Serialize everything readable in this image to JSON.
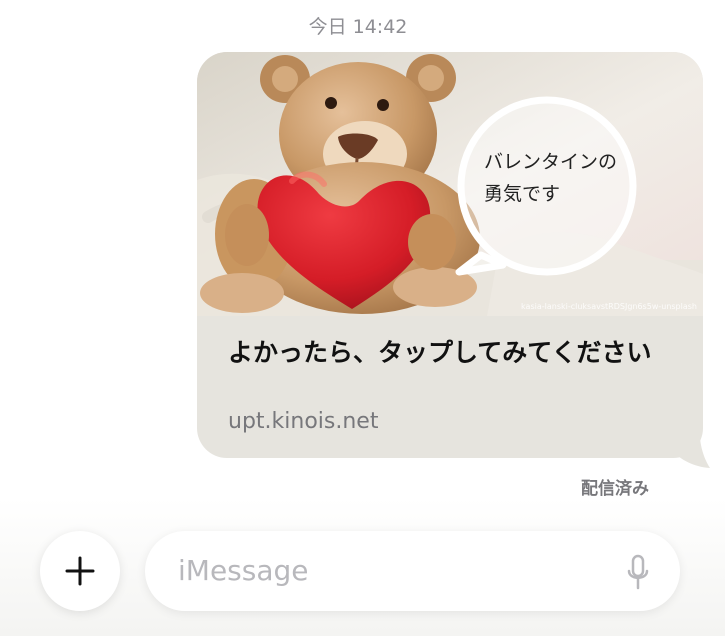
{
  "timestamp": "今日 14:42",
  "message": {
    "image_bubble_text": "バレンタインの\n勇気です",
    "photo_credit": "kasia-lanski-cluksavstRDSJgn6s5w-unsplash",
    "link_title": "よかったら、タップしてみてください",
    "link_domain": "upt.kinois.net",
    "status": "配信済み"
  },
  "input": {
    "placeholder": "iMessage",
    "plus_icon": "plus-icon",
    "mic_icon": "microphone-icon"
  },
  "colors": {
    "bubble_background": "#e6e4de",
    "heart": "#d61f2a",
    "bear": "#c79a6d",
    "placeholder": "#b8b8bc"
  }
}
